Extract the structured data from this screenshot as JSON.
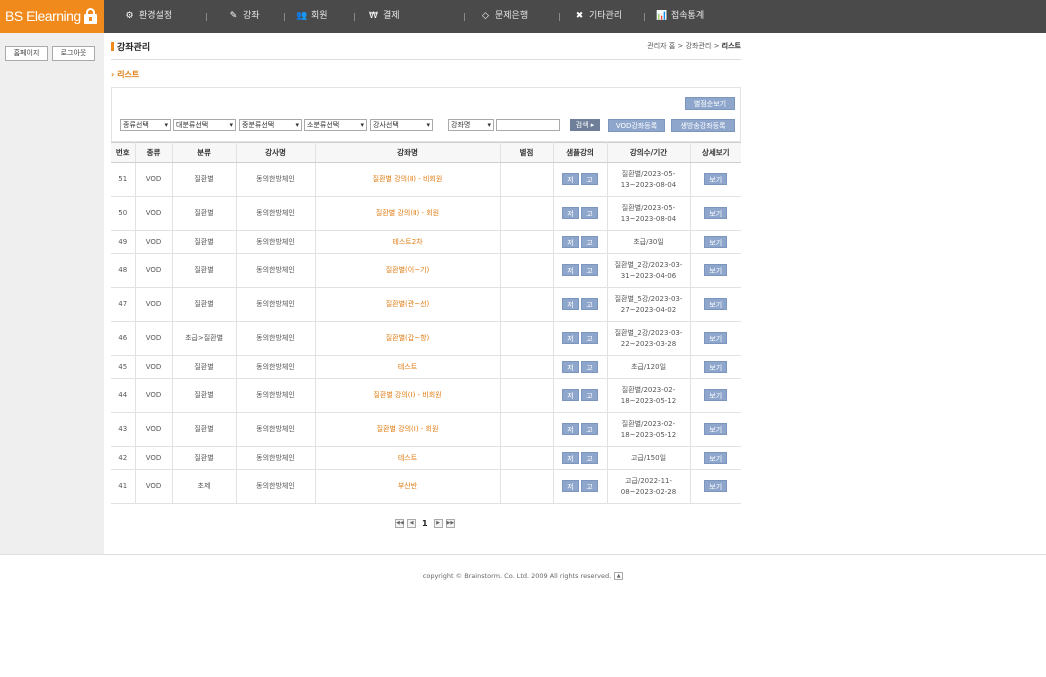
{
  "app": {
    "logo_text": "BS Elearning"
  },
  "nav": [
    {
      "label": "환경설정",
      "icon": "settings-icon",
      "glyph": "⚙"
    },
    {
      "label": "강좌",
      "icon": "edit-icon",
      "glyph": "✎"
    },
    {
      "label": "회원",
      "icon": "users-icon",
      "glyph": "👥"
    },
    {
      "label": "결제",
      "icon": "coins-icon",
      "glyph": "₩"
    },
    {
      "label": "문제은행",
      "icon": "diamond-icon",
      "glyph": "◇"
    },
    {
      "label": "기타관리",
      "icon": "tools-icon",
      "glyph": "✖"
    },
    {
      "label": "접속통계",
      "icon": "bar-chart-icon",
      "glyph": "📊"
    }
  ],
  "sidebar": {
    "home_label": "홈페이지",
    "logout_label": "로그아웃"
  },
  "header": {
    "title": "강좌관리",
    "breadcrumb_prefix": "관리자 홈 > 강좌관리 > ",
    "breadcrumb_current": "리스트"
  },
  "section": {
    "label": "리스트"
  },
  "toolbar": {
    "sort_rating_label": "별점순보기",
    "filters": [
      "종류선택",
      "대분류선택",
      "중분류선택",
      "소분류선택",
      "강사선택"
    ],
    "search_field": "강좌명",
    "search_value": "",
    "search_label": "검색",
    "register_vod_label": "VOD강좌등록",
    "register_live_label": "생방송강좌등록"
  },
  "table": {
    "headers": [
      "번호",
      "종류",
      "분류",
      "강사명",
      "강좌명",
      "별점",
      "샘플강의",
      "강의수/기간",
      "상세보기"
    ],
    "sample_low": "저",
    "sample_high": "고",
    "view_label": "보기",
    "rows": [
      {
        "no": "51",
        "type": "VOD",
        "category": "질환별",
        "teacher": "동의한방체인",
        "title": "질환별 강의(Ⅱ) - 비회원",
        "rating": "",
        "period": "질환별/2023-05-13~2023-08-04",
        "tall": true
      },
      {
        "no": "50",
        "type": "VOD",
        "category": "질환별",
        "teacher": "동의한방체인",
        "title": "질환별 강의(Ⅱ) - 회원",
        "rating": "",
        "period": "질환별/2023-05-13~2023-08-04",
        "tall": true
      },
      {
        "no": "49",
        "type": "VOD",
        "category": "질환별",
        "teacher": "동의한방체인",
        "title": "테스트2차",
        "rating": "",
        "period": "초급/30일",
        "tall": false
      },
      {
        "no": "48",
        "type": "VOD",
        "category": "질환별",
        "teacher": "동의한방체인",
        "title": "질환별(이~기)",
        "rating": "",
        "period": "질환별_2강/2023-03-31~2023-04-06",
        "tall": true
      },
      {
        "no": "47",
        "type": "VOD",
        "category": "질환별",
        "teacher": "동의한방체인",
        "title": "질환별(관~선)",
        "rating": "",
        "period": "질환별_5강/2023-03-27~2023-04-02",
        "tall": true
      },
      {
        "no": "46",
        "type": "VOD",
        "category": "초급>질환별",
        "teacher": "동의한방체인",
        "title": "질환별(갑~항)",
        "rating": "",
        "period": "질환별_2강/2023-03-22~2023-03-28",
        "tall": true
      },
      {
        "no": "45",
        "type": "VOD",
        "category": "질환별",
        "teacher": "동의한방체인",
        "title": "테스트",
        "rating": "",
        "period": "초급/120일",
        "tall": false
      },
      {
        "no": "44",
        "type": "VOD",
        "category": "질환별",
        "teacher": "동의한방체인",
        "title": "질환별 강의(Ⅰ) - 비회원",
        "rating": "",
        "period": "질환별/2023-02-18~2023-05-12",
        "tall": true
      },
      {
        "no": "43",
        "type": "VOD",
        "category": "질환별",
        "teacher": "동의한방체인",
        "title": "질환별 강의(Ⅰ) - 회원",
        "rating": "",
        "period": "질환별/2023-02-18~2023-05-12",
        "tall": true
      },
      {
        "no": "42",
        "type": "VOD",
        "category": "질환별",
        "teacher": "동의한방체인",
        "title": "테스트",
        "rating": "",
        "period": "고급/150일",
        "tall": false
      },
      {
        "no": "41",
        "type": "VOD",
        "category": "초제",
        "teacher": "동의한방체인",
        "title": "부산반",
        "rating": "",
        "period": "고급/2022-11-08~2023-02-28",
        "tall": true
      }
    ]
  },
  "pagination": {
    "current_page": "1"
  },
  "footer": {
    "copyright": "copyright © Brainstorm. Co. Ltd. 2009 All rights reserved."
  },
  "colors": {
    "accent": "#f08a1d",
    "topbar": "#4a4a4a",
    "button": "#8ea6cc"
  }
}
